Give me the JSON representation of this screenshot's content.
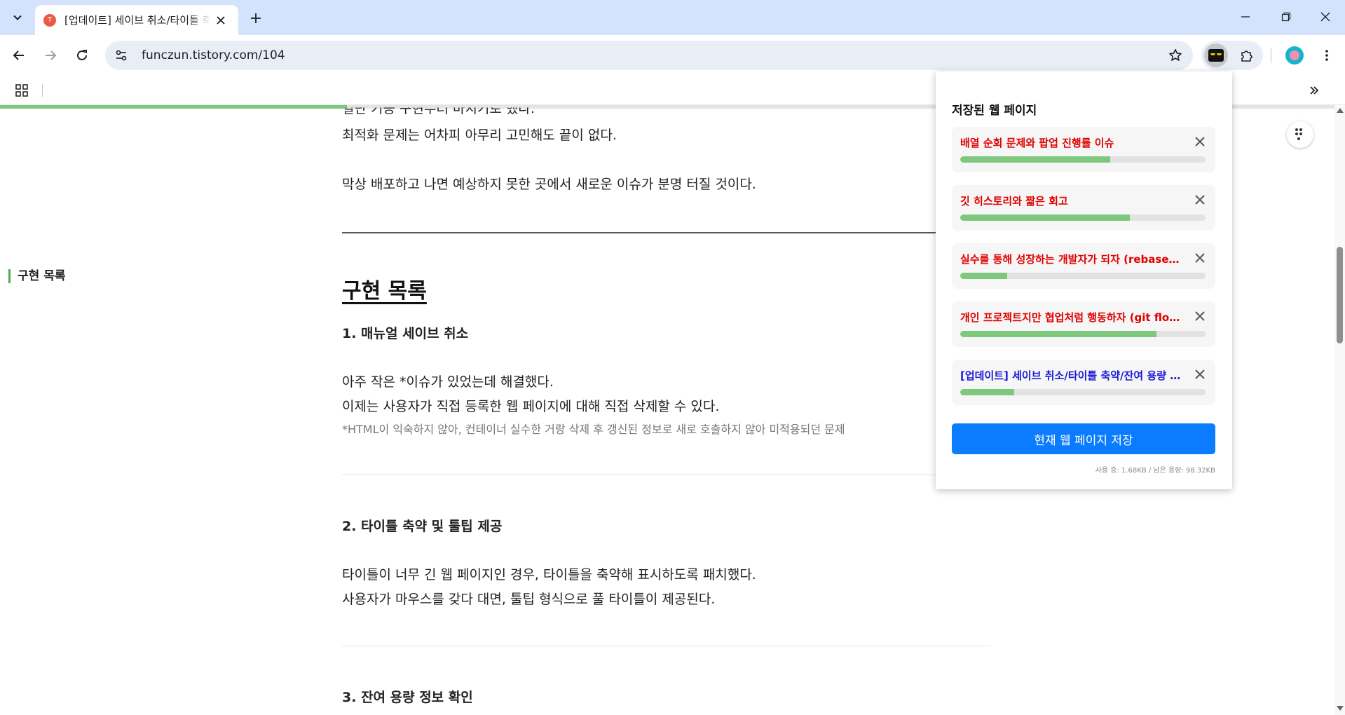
{
  "browser": {
    "tab": {
      "title": "[업데이트] 세이브 취소/타이틀 축약/잔여 용량 체크",
      "favicon_glyph": "T"
    },
    "url": "funczun.tistory.com/104",
    "icons": {
      "tab_search": "chevron-down-icon",
      "tab_close": "close-icon",
      "new_tab": "plus-icon",
      "minimize": "minimize-icon",
      "restore": "restore-icon",
      "close": "close-icon",
      "back": "arrow-left-icon",
      "forward": "arrow-right-icon",
      "reload": "reload-icon",
      "site_info": "tune-icon",
      "bookmark": "star-icon",
      "extension": "owl-face-icon",
      "extensions_menu": "puzzle-icon",
      "profile": "avatar-icon",
      "menu": "three-dots-vertical-icon",
      "apps": "grid-icon",
      "bookmarks_overflow": "double-chevron-right-icon"
    }
  },
  "page": {
    "reading_progress_percent": 26,
    "toc_label": "구현 목록",
    "lines": {
      "cut": "일단 기능 구현부터 마치기로 했다.",
      "p1": "최적화 문제는 어차피 아무리 고민해도 끝이 없다.",
      "p2": "막상 배포하고 나면 예상하지 못한 곳에서 새로운 이슈가 분명 터질 것이다.",
      "h2": "구현 목록",
      "s1_title": "1. 매뉴얼 세이브 취소",
      "s1_p1": "아주 작은 *이슈가 있었는데 해결했다.",
      "s1_p2": "이제는 사용자가 직접 등록한 웹 페이지에 대해 직접 삭제할 수 있다.",
      "s1_note": "*HTML이 익숙하지 않아, 컨테이너 실수한 거랑 삭제 후 갱신된 정보로 새로 호출하지 않아 미적용되던 문제",
      "s2_title": "2. 타이틀 축약 및 툴팁 제공",
      "s2_p1": "타이틀이 너무 긴 웹 페이지인 경우, 타이틀을 축약해 표시하도록 패치했다.",
      "s2_p2": "사용자가 마우스를 갖다 대면, 툴팁 형식으로 풀 타이틀이 제공된다.",
      "s3_title": "3. 잔여 용량 정보 확인"
    },
    "float_icon": "tree-menu-icon"
  },
  "popup": {
    "title": "저장된 웹 페이지",
    "items": [
      {
        "title": "배열 순회 문제와 팝업 진행률 이슈",
        "progress": 0.61,
        "current": false
      },
      {
        "title": "깃 히스토리와 짧은 회고",
        "progress": 0.69,
        "current": false
      },
      {
        "title": "실수를 통해 성장하는 개발자가 되자 (rebase? c...",
        "progress": 0.19,
        "current": false
      },
      {
        "title": "개인 프로젝트지만 협업처럼 행동하자 (git flow, ...",
        "progress": 0.8,
        "current": false
      },
      {
        "title": "[업데이트] 세이브 취소/타이틀 축약/잔여 용량 체...",
        "progress": 0.22,
        "current": true
      }
    ],
    "save_button": "현재 웹 페이지 저장",
    "usage": "사용 중: 1.68KB / 남은 용량: 98.32KB",
    "colors": {
      "title": "#e00000",
      "current_title": "#1a1ad6",
      "progress": "#7ec87e",
      "button": "#0b7bff"
    }
  }
}
